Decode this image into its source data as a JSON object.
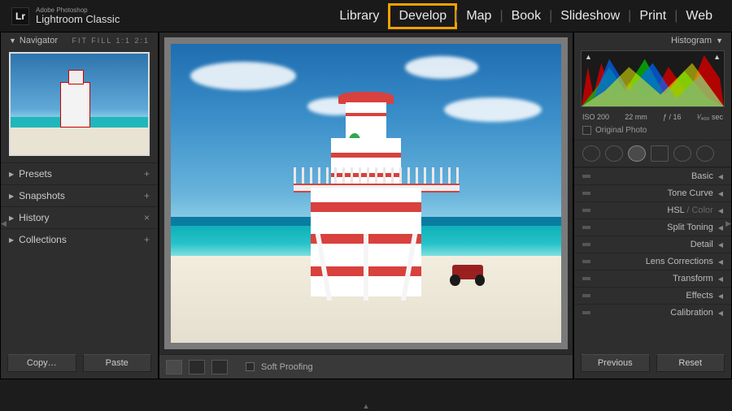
{
  "brand": {
    "super": "Adobe Photoshop",
    "name": "Lightroom Classic",
    "logo": "Lr"
  },
  "modules": [
    "Library",
    "Develop",
    "Map",
    "Book",
    "Slideshow",
    "Print",
    "Web"
  ],
  "active_module": "Develop",
  "left": {
    "navigator": {
      "label": "Navigator",
      "zoom_modes": "FIT   FILL   1:1   2:1"
    },
    "panels": [
      {
        "label": "Presets",
        "action": "+"
      },
      {
        "label": "Snapshots",
        "action": "+"
      },
      {
        "label": "History",
        "action": "×"
      },
      {
        "label": "Collections",
        "action": "+"
      }
    ],
    "footer": {
      "copy": "Copy…",
      "paste": "Paste"
    }
  },
  "toolbar": {
    "soft_proof": "Soft Proofing"
  },
  "right": {
    "histogram_label": "Histogram",
    "meta": {
      "iso": "ISO 200",
      "focal": "22 mm",
      "aperture": "ƒ / 16",
      "shutter": "¹⁄₄₀₀ sec"
    },
    "original": "Original Photo",
    "panels": [
      "Basic",
      "Tone Curve",
      "HSL / Color",
      "Split Toning",
      "Detail",
      "Lens Corrections",
      "Transform",
      "Effects",
      "Calibration"
    ],
    "footer": {
      "prev": "Previous",
      "reset": "Reset"
    }
  }
}
